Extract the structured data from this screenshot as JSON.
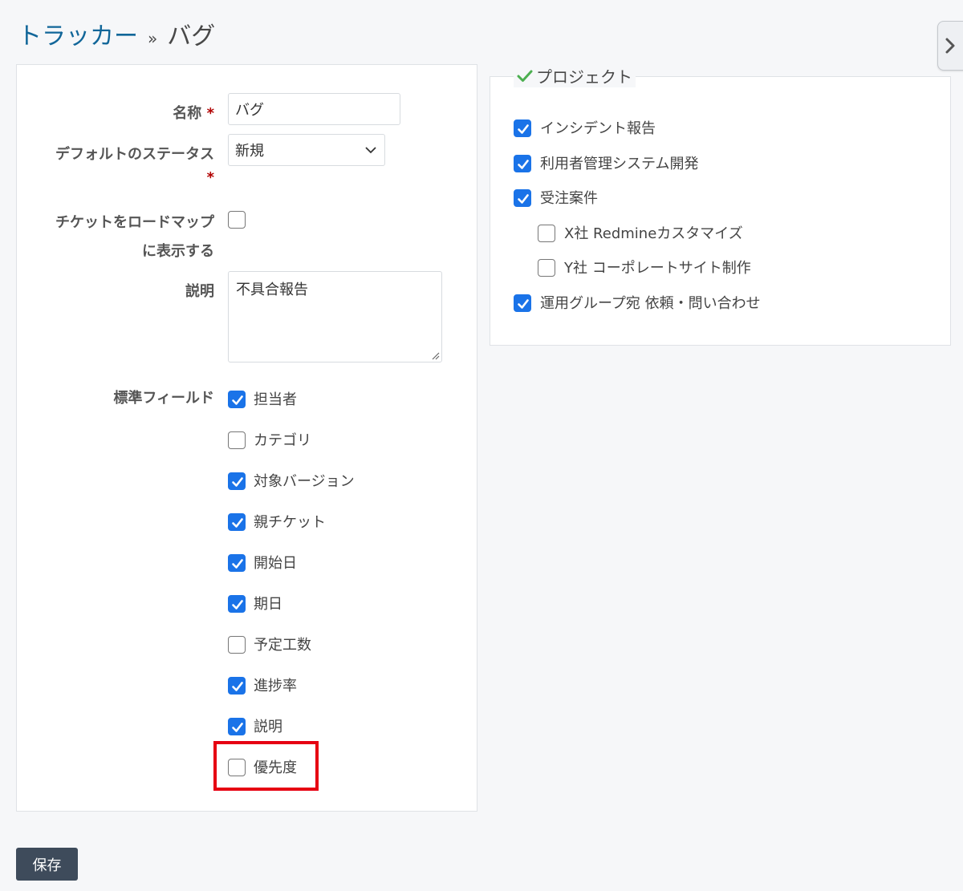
{
  "breadcrumb": {
    "parent": "トラッカー",
    "separator": "»",
    "current": "バグ"
  },
  "form": {
    "name_label": "名称",
    "name_value": "バグ",
    "default_status_label": "デフォルトのステータス",
    "default_status_value": "新規",
    "roadmap_label_line1": "チケットをロードマップ",
    "roadmap_label_line2": "に表示する",
    "roadmap_checked": false,
    "description_label": "説明",
    "description_value": "不具合報告",
    "required_mark": "*",
    "standard_fields_label": "標準フィールド",
    "standard_fields": [
      {
        "label": "担当者",
        "checked": true
      },
      {
        "label": "カテゴリ",
        "checked": false
      },
      {
        "label": "対象バージョン",
        "checked": true
      },
      {
        "label": "親チケット",
        "checked": true
      },
      {
        "label": "開始日",
        "checked": true
      },
      {
        "label": "期日",
        "checked": true
      },
      {
        "label": "予定工数",
        "checked": false
      },
      {
        "label": "進捗率",
        "checked": true
      },
      {
        "label": "説明",
        "checked": true
      },
      {
        "label": "優先度",
        "checked": false
      }
    ]
  },
  "projects": {
    "legend": "プロジェクト",
    "items": [
      {
        "label": "インシデント報告",
        "checked": true,
        "level": 0
      },
      {
        "label": "利用者管理システム開発",
        "checked": true,
        "level": 0
      },
      {
        "label": "受注案件",
        "checked": true,
        "level": 0
      },
      {
        "label": "X社 Redmineカスタマイズ",
        "checked": false,
        "level": 1
      },
      {
        "label": "Y社 コーポレートサイト制作",
        "checked": false,
        "level": 1
      },
      {
        "label": "運用グループ宛 依頼・問い合わせ",
        "checked": true,
        "level": 0
      }
    ]
  },
  "save_label": "保存",
  "colors": {
    "link": "#116699",
    "checkbox_checked": "#1a73e8",
    "highlight": "#e60012",
    "save_button": "#3e4b5b",
    "required": "#b10000",
    "legend_check": "#4caf50"
  }
}
